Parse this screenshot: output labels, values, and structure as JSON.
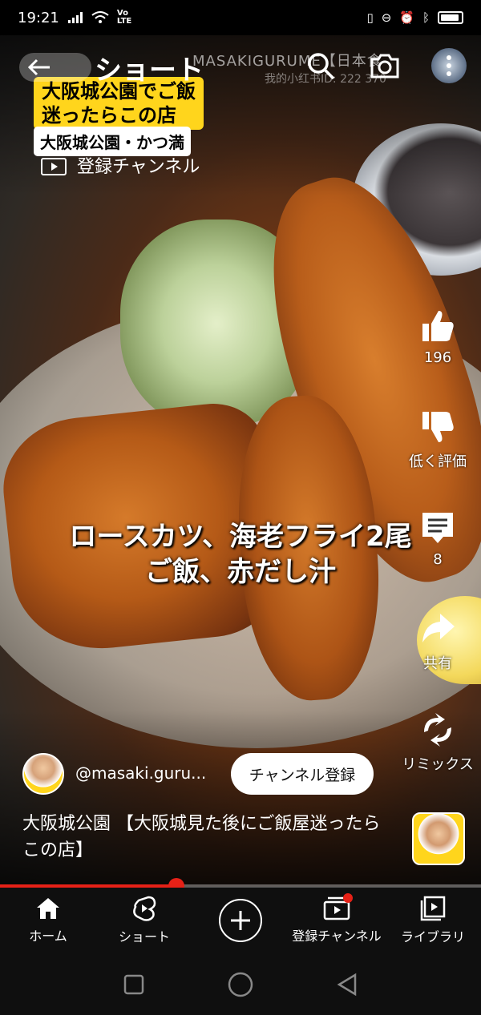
{
  "status_bar": {
    "time": "19:21",
    "signal_icon": "signal-icon",
    "wifi_icon": "wifi-icon",
    "volte": "Vo\nLTE",
    "right_icons": [
      "vibrate-icon",
      "do-not-disturb-icon",
      "alarm-icon",
      "bluetooth-icon",
      "battery-icon"
    ]
  },
  "header": {
    "back_icon": "arrow-left-icon",
    "title": "ショート",
    "search_icon": "search-icon",
    "camera_icon": "camera-icon",
    "menu_icon": "more-vertical-icon"
  },
  "video": {
    "watermark": "MASAKIGURUME【日本食",
    "watermark_sub": "我的小红书ID: 222  370",
    "caption_yellow_line1": "大阪城公園でご飯",
    "caption_yellow_line2": "迷ったらこの店",
    "caption_white": "大阪城公園・かつ満",
    "subscriptions_link": "登録チャンネル",
    "subtitle_line1": "ロースカツ、海老フライ2尾",
    "subtitle_line2": "ご飯、赤だし汁"
  },
  "actions": {
    "like": {
      "icon": "thumbs-up-icon",
      "label": "196"
    },
    "dislike": {
      "icon": "thumbs-down-icon",
      "label": "低く評価"
    },
    "comments": {
      "icon": "comment-icon",
      "label": "8"
    },
    "share": {
      "icon": "share-icon",
      "label": "共有"
    },
    "remix": {
      "icon": "remix-icon",
      "label": "リミックス"
    }
  },
  "channel": {
    "handle": "@masaki.guru...",
    "subscribe_label": "チャンネル登録",
    "title": "大阪城公園 【大阪城見た後にご飯屋迷ったらこの店】"
  },
  "progress": {
    "fraction": 0.367
  },
  "bottom_nav": {
    "items": [
      {
        "icon": "home-icon",
        "label": "ホーム"
      },
      {
        "icon": "shorts-icon",
        "label": "ショート"
      },
      {
        "icon": "create-icon",
        "label": ""
      },
      {
        "icon": "subscriptions-icon",
        "label": "登録チャンネル"
      },
      {
        "icon": "library-icon",
        "label": "ライブラリ"
      }
    ]
  },
  "colors": {
    "accent": "#e62117",
    "caption_yellow": "#ffd51c",
    "nav_bg": "#0f0f0f"
  }
}
